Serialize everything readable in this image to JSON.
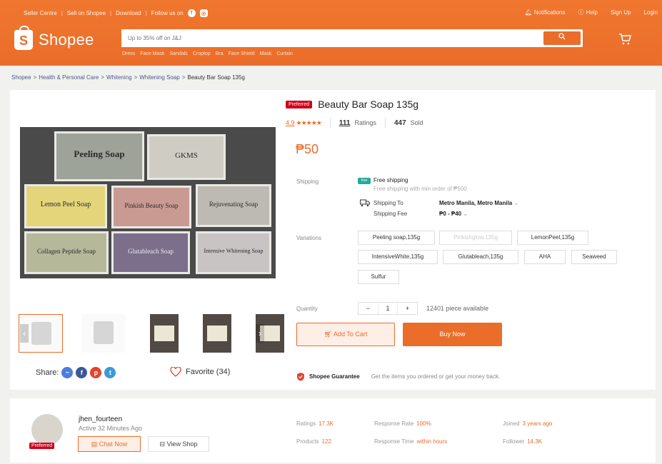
{
  "topbar": {
    "left": [
      "Seller Centre",
      "Sell on Shopee",
      "Download",
      "Follow us on"
    ],
    "right": {
      "notifications": "Notifications",
      "help": "Help",
      "signup": "Sign Up",
      "login": "Login"
    }
  },
  "header": {
    "logo_text": "Shopee",
    "search_placeholder": "Up to 35% off on J&J",
    "hints": [
      "Dress",
      "Face Mask",
      "Sandals",
      "Croptop",
      "Bra",
      "Face Shield",
      "Mask",
      "Curtain"
    ]
  },
  "breadcrumb": [
    "Shopee",
    "Health & Personal Care",
    "Whitening",
    "Whitening Soap",
    "Beauty Bar Soap 135g"
  ],
  "product": {
    "badge": "Preferred",
    "name": "Beauty Bar Soap 135g",
    "rating": "4.9",
    "stars": "★★★★★",
    "ratings_count": "111",
    "ratings_label": "Ratings",
    "sold_count": "447",
    "sold_label": "Sold",
    "price": "₱50",
    "soap_labels": [
      "Peeling Soap",
      "GKMS",
      "Lemon Peel Soap",
      "Pinkish Beauty Soap",
      "Rejuvenating Soap",
      "Collagen Peptide Soap",
      "Glutableach Soap",
      "Intensive Whitening Soap"
    ]
  },
  "shipping": {
    "label": "Shipping",
    "free_icon": "free",
    "free": "Free shipping",
    "free_sub": "Free shipping with min order of ₱500",
    "to_label": "Shipping To",
    "to_value": "Metro Manila, Metro Manila",
    "fee_label": "Shipping Fee",
    "fee_value": "₱0 - ₱40"
  },
  "variations": {
    "label": "Variations",
    "options": [
      "Peeling soap,135g",
      "Pinkishglow,135g",
      "LemonPeel,135g",
      "IntensiveWhite,135g",
      "Glutableach,135g",
      "AHA",
      "Seaweed",
      "Sulfur"
    ]
  },
  "quantity": {
    "label": "Quantity",
    "minus": "−",
    "value": "1",
    "plus": "+",
    "available": "12401 piece available"
  },
  "actions": {
    "add_to_cart": "Add To Cart",
    "buy_now": "Buy Now"
  },
  "share": {
    "label": "Share:",
    "favorite": "Favorite (34)"
  },
  "guarantee": {
    "title": "Shopee Guarantee",
    "text": "Get the items you ordered or get your money back."
  },
  "shop": {
    "name": "jhen_fourteen",
    "active": "Active 32 Minutes Ago",
    "badge": "Preferred",
    "chat": "Chat Now",
    "view": "View Shop",
    "stats": {
      "ratings_label": "Ratings",
      "ratings": "17.3K",
      "products_label": "Products",
      "products": "122",
      "response_rate_label": "Response Rate",
      "response_rate": "100%",
      "response_time_label": "Response Time",
      "response_time": "within hours",
      "joined_label": "Joined",
      "joined": "3 years ago",
      "follower_label": "Follower",
      "follower": "14.3K"
    }
  },
  "colors": {
    "brand": "#ea6d2a",
    "preferred": "#d0011b"
  }
}
